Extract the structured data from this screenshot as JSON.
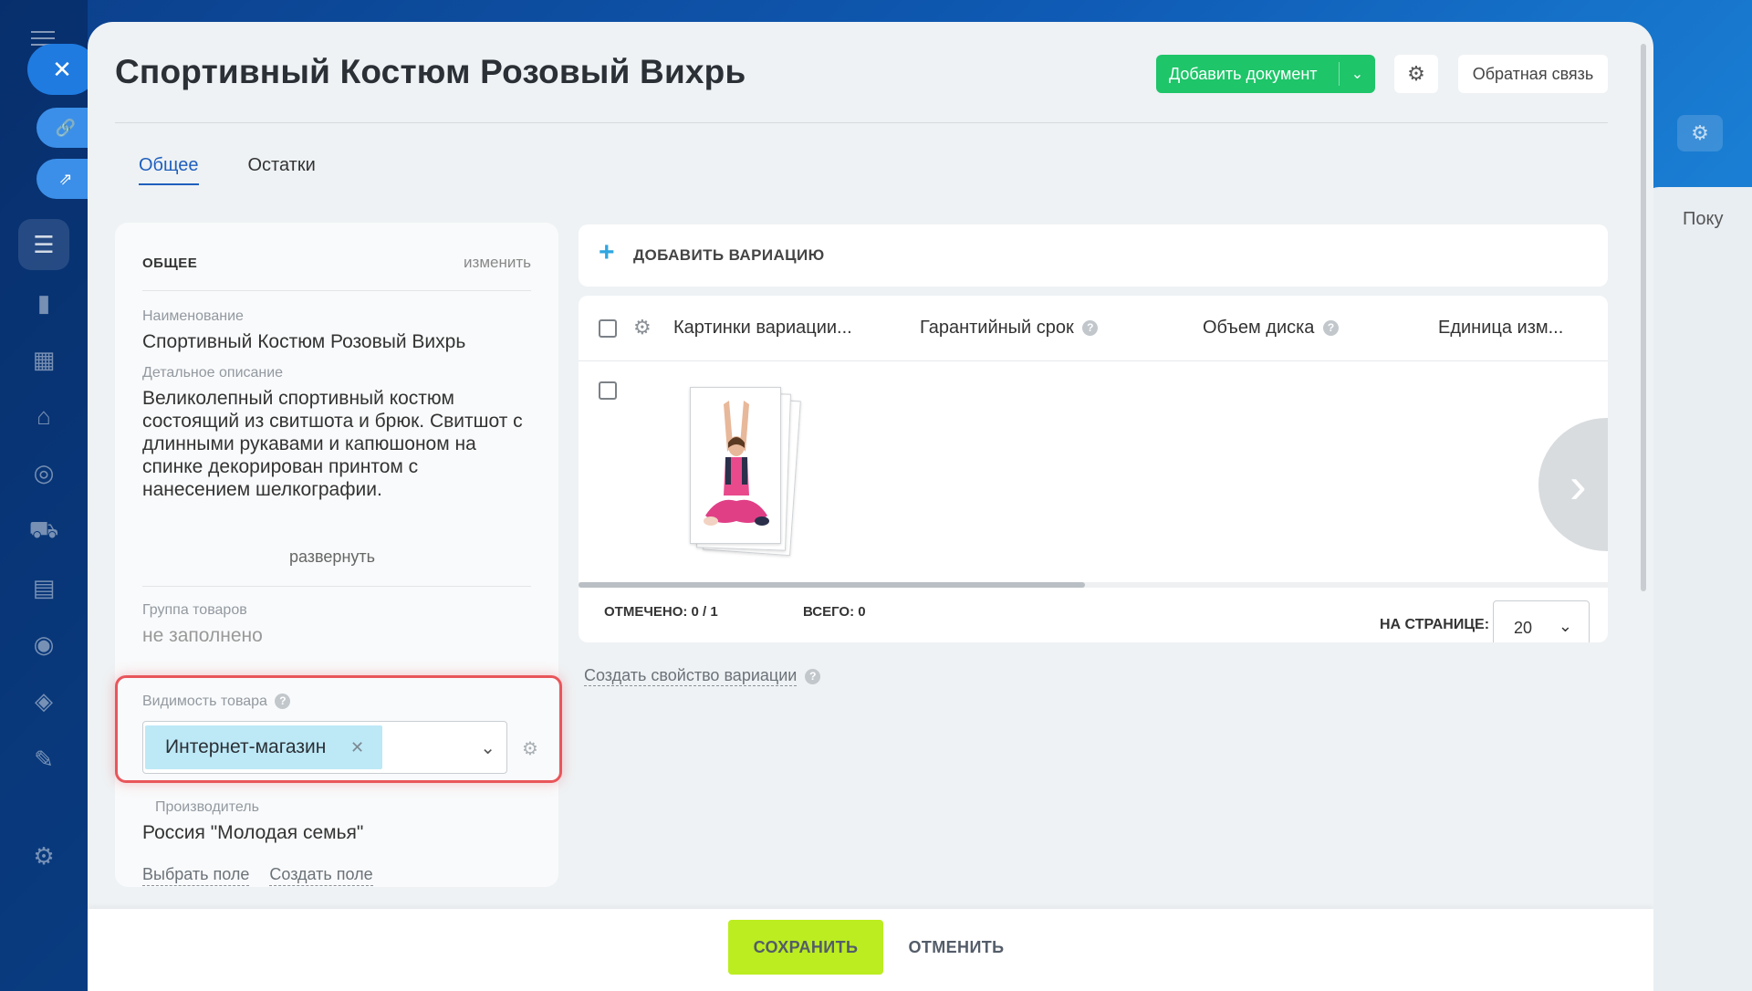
{
  "page": {
    "title": "Спортивный Костюм Розовый Вихрь"
  },
  "header": {
    "add_document_label": "Добавить документ",
    "feedback_label": "Обратная связь"
  },
  "tabs": [
    {
      "label": "Общее",
      "active": true
    },
    {
      "label": "Остатки",
      "active": false
    }
  ],
  "general_card": {
    "heading": "ОБЩЕЕ",
    "edit_label": "изменить",
    "name_label": "Наименование",
    "name_value": "Спортивный Костюм Розовый Вихрь",
    "description_label": "Детальное описание",
    "description_value": "Великолепный спортивный костюм состоящий из свитшота и брюк. Свитшот с длинными рукавами и капюшоном на спинке декорирован принтом с нанесением шелкографии.",
    "expand_label": "развернуть",
    "group_label": "Группа товаров",
    "group_value": "не заполнено",
    "visibility_label": "Видимость товара",
    "visibility_tag": "Интернет-магазин",
    "manufacturer_label": "Производитель",
    "manufacturer_value": "Россия \"Молодая семья\"",
    "select_field_label": "Выбрать поле",
    "create_field_label": "Создать поле"
  },
  "variations": {
    "add_label": "ДОБАВИТЬ ВАРИАЦИЮ",
    "columns": [
      "Картинки вариации...",
      "Гарантийный срок",
      "Объем диска",
      "Единица изм..."
    ],
    "marked_label": "ОТМЕЧЕНО:",
    "marked_value": "0 / 1",
    "total_label": "ВСЕГО:",
    "total_value": "0",
    "per_page_label": "НА СТРАНИЦЕ:",
    "per_page_value": "20",
    "create_property_label": "Создать свойство вариации"
  },
  "footer": {
    "save_label": "СОХРАНИТЬ",
    "cancel_label": "ОТМЕНИТЬ"
  },
  "background": {
    "right_panel_text": "Поку"
  },
  "colors": {
    "accent_green": "#1ec569",
    "save_green": "#bbed21",
    "tab_active": "#1f5fbd",
    "highlight_red": "#e8565b",
    "tag_bg": "#bde8f6"
  }
}
